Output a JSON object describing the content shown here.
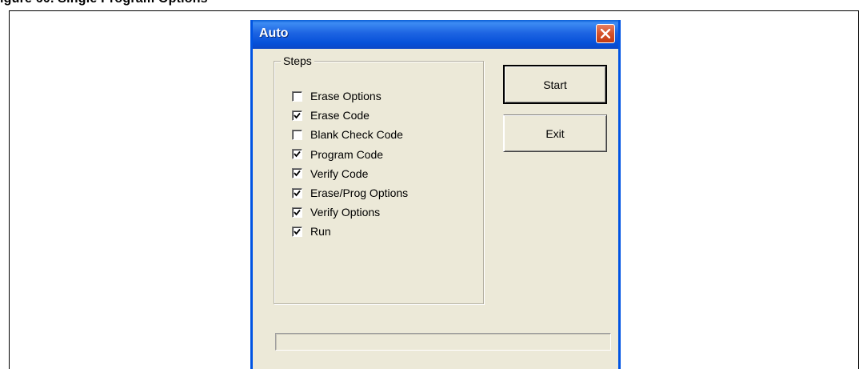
{
  "caption_fragment": "igure 60.   Single Program Options",
  "dialog": {
    "title": "Auto",
    "close_icon": "close-x-icon",
    "group_title": "Steps",
    "steps": [
      {
        "label": "Erase Options",
        "checked": false
      },
      {
        "label": "Erase Code",
        "checked": true
      },
      {
        "label": "Blank Check Code",
        "checked": false
      },
      {
        "label": "Program Code",
        "checked": true
      },
      {
        "label": "Verify Code",
        "checked": true
      },
      {
        "label": "Erase/Prog Options",
        "checked": true
      },
      {
        "label": "Verify Options",
        "checked": true
      },
      {
        "label": "Run",
        "checked": true
      }
    ],
    "buttons": {
      "start": "Start",
      "exit": "Exit"
    },
    "progress": 0,
    "colors": {
      "title_bar": "#0651d9",
      "face": "#ece9d8",
      "close_button": "#d5522b"
    }
  }
}
